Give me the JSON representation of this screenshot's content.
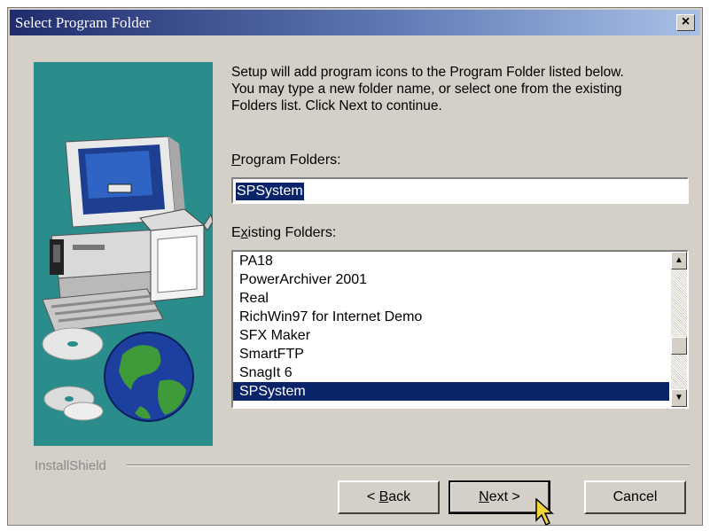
{
  "window": {
    "title": "Select Program Folder",
    "close_label": "×"
  },
  "description": [
    "Setup will add program icons to the Program Folder listed below.",
    "You may type a new folder name, or select one from the existing",
    "Folders list.  Click Next to continue."
  ],
  "program_folders": {
    "label_accel": "P",
    "label_rest": "rogram Folders:",
    "value": "SPSystem"
  },
  "existing_folders": {
    "label_pre": "E",
    "label_accel": "x",
    "label_rest": "isting Folders:",
    "items": [
      "PA18",
      "PowerArchiver 2001",
      "Real",
      "RichWin97 for Internet Demo",
      "SFX Maker",
      "SmartFTP",
      "SnagIt  6",
      "SPSystem"
    ],
    "selected_index": 7
  },
  "scrollbar": {
    "up_arrow": "▲",
    "down_arrow": "▼"
  },
  "footer": {
    "brand": "InstallShield"
  },
  "buttons": {
    "back_prefix": "< ",
    "back_accel": "B",
    "back_rest": "ack",
    "next_accel": "N",
    "next_rest": "ext >",
    "cancel": "Cancel"
  }
}
